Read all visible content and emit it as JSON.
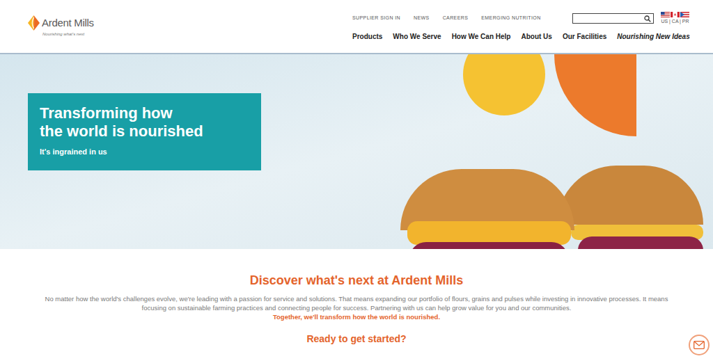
{
  "logo": {
    "name": "Ardent Mills",
    "tagline": "Nourishing what's next"
  },
  "utility_nav": [
    "SUPPLIER SIGN IN",
    "NEWS",
    "CAREERS",
    "EMERGING NUTRITION"
  ],
  "locale_label": "US | CA | PR",
  "main_nav": [
    {
      "label": "Products",
      "kind": "link"
    },
    {
      "label": "Who We Serve",
      "kind": "link"
    },
    {
      "label": "How We Can Help",
      "kind": "link"
    },
    {
      "label": "About Us",
      "kind": "link"
    },
    {
      "label": "Our Facilities",
      "kind": "link"
    },
    {
      "label": "Nourishing New Ideas",
      "kind": "feature"
    }
  ],
  "hero": {
    "title_lines": [
      "Transforming how",
      "the world is nourished"
    ],
    "subtitle": "It's ingrained in us"
  },
  "intro": {
    "heading": "Discover what's next at Ardent Mills",
    "body": "No matter how the world's challenges evolve, we're leading with a passion for service and solutions. That means expanding our portfolio of flours, grains and pulses while investing in innovative processes. It means focusing on sustainable farming practices and connecting people for success. Partnering with us can help grow value for you and our communities.",
    "tagline": "Together, we'll transform how the world is nourished."
  },
  "cta": {
    "heading": "Ready to get started?"
  }
}
